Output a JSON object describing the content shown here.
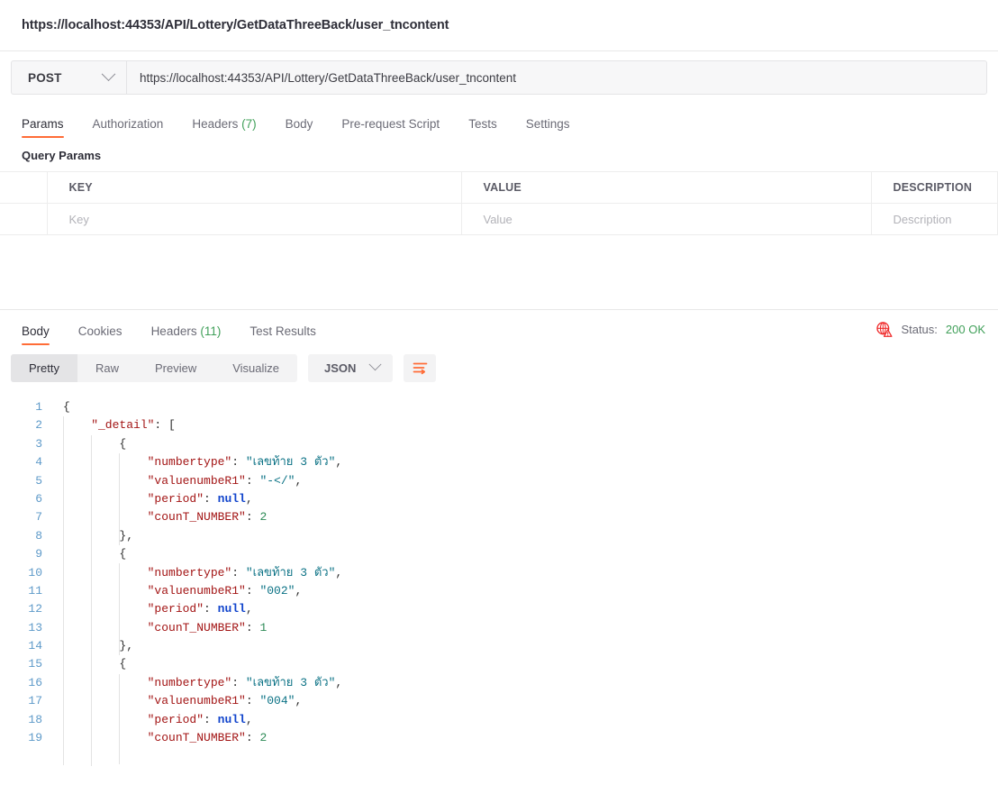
{
  "title_bar": {
    "url_title": "https://localhost:44353/API/Lottery/GetDataThreeBack/user_tncontent"
  },
  "request": {
    "method": "POST",
    "url": "https://localhost:44353/API/Lottery/GetDataThreeBack/user_tncontent"
  },
  "request_tabs": [
    {
      "label": "Params",
      "count": "",
      "active": true
    },
    {
      "label": "Authorization",
      "count": "",
      "active": false
    },
    {
      "label": "Headers",
      "count": "(7)",
      "active": false
    },
    {
      "label": "Body",
      "count": "",
      "active": false
    },
    {
      "label": "Pre-request Script",
      "count": "",
      "active": false
    },
    {
      "label": "Tests",
      "count": "",
      "active": false
    },
    {
      "label": "Settings",
      "count": "",
      "active": false
    }
  ],
  "params": {
    "section_label": "Query Params",
    "columns": [
      "KEY",
      "VALUE",
      "DESCRIPTION"
    ],
    "rows": [
      {
        "key": "Key",
        "value": "Value",
        "description": "Description"
      }
    ]
  },
  "response_tabs": [
    {
      "label": "Body",
      "count": "",
      "active": true
    },
    {
      "label": "Cookies",
      "count": "",
      "active": false
    },
    {
      "label": "Headers",
      "count": "(11)",
      "active": false
    },
    {
      "label": "Test Results",
      "count": "",
      "active": false
    }
  ],
  "response_status": {
    "icon": "globe-warning-icon",
    "label": "Status:",
    "value": "200 OK",
    "ok_color": "#41a05a",
    "icon_color": "#ef2b2b"
  },
  "viewer": {
    "modes": [
      {
        "label": "Pretty",
        "active": true
      },
      {
        "label": "Raw",
        "active": false
      },
      {
        "label": "Preview",
        "active": false
      },
      {
        "label": "Visualize",
        "active": false
      }
    ],
    "format": "JSON",
    "wrap_icon": "wrap-lines-icon",
    "accent": "#ff6c37"
  },
  "code": {
    "language": "json",
    "lines": [
      {
        "n": 1,
        "tokens": [
          {
            "t": "{",
            "c": "tk-brace"
          }
        ]
      },
      {
        "n": 2,
        "tokens": [
          {
            "t": "    \"_detail\"",
            "c": "tk-key"
          },
          {
            "t": ": [",
            "c": "tk-punc"
          }
        ]
      },
      {
        "n": 3,
        "tokens": [
          {
            "t": "        {",
            "c": "tk-punc"
          }
        ]
      },
      {
        "n": 4,
        "tokens": [
          {
            "t": "            \"numbertype\"",
            "c": "tk-key"
          },
          {
            "t": ": ",
            "c": "tk-punc"
          },
          {
            "t": "\"เลขท้าย 3 ตัว\"",
            "c": "tk-str"
          },
          {
            "t": ",",
            "c": "tk-punc"
          }
        ]
      },
      {
        "n": 5,
        "tokens": [
          {
            "t": "            \"valuenumbeR1\"",
            "c": "tk-key"
          },
          {
            "t": ": ",
            "c": "tk-punc"
          },
          {
            "t": "\"-</\"",
            "c": "tk-str"
          },
          {
            "t": ",",
            "c": "tk-punc"
          }
        ]
      },
      {
        "n": 6,
        "tokens": [
          {
            "t": "            \"period\"",
            "c": "tk-key"
          },
          {
            "t": ": ",
            "c": "tk-punc"
          },
          {
            "t": "null",
            "c": "tk-null"
          },
          {
            "t": ",",
            "c": "tk-punc"
          }
        ]
      },
      {
        "n": 7,
        "tokens": [
          {
            "t": "            \"counT_NUMBER\"",
            "c": "tk-key"
          },
          {
            "t": ": ",
            "c": "tk-punc"
          },
          {
            "t": "2",
            "c": "tk-num"
          }
        ]
      },
      {
        "n": 8,
        "tokens": [
          {
            "t": "        },",
            "c": "tk-punc"
          }
        ]
      },
      {
        "n": 9,
        "tokens": [
          {
            "t": "        {",
            "c": "tk-punc"
          }
        ]
      },
      {
        "n": 10,
        "tokens": [
          {
            "t": "            \"numbertype\"",
            "c": "tk-key"
          },
          {
            "t": ": ",
            "c": "tk-punc"
          },
          {
            "t": "\"เลขท้าย 3 ตัว\"",
            "c": "tk-str"
          },
          {
            "t": ",",
            "c": "tk-punc"
          }
        ]
      },
      {
        "n": 11,
        "tokens": [
          {
            "t": "            \"valuenumbeR1\"",
            "c": "tk-key"
          },
          {
            "t": ": ",
            "c": "tk-punc"
          },
          {
            "t": "\"002\"",
            "c": "tk-str"
          },
          {
            "t": ",",
            "c": "tk-punc"
          }
        ]
      },
      {
        "n": 12,
        "tokens": [
          {
            "t": "            \"period\"",
            "c": "tk-key"
          },
          {
            "t": ": ",
            "c": "tk-punc"
          },
          {
            "t": "null",
            "c": "tk-null"
          },
          {
            "t": ",",
            "c": "tk-punc"
          }
        ]
      },
      {
        "n": 13,
        "tokens": [
          {
            "t": "            \"counT_NUMBER\"",
            "c": "tk-key"
          },
          {
            "t": ": ",
            "c": "tk-punc"
          },
          {
            "t": "1",
            "c": "tk-num"
          }
        ]
      },
      {
        "n": 14,
        "tokens": [
          {
            "t": "        },",
            "c": "tk-punc"
          }
        ]
      },
      {
        "n": 15,
        "tokens": [
          {
            "t": "        {",
            "c": "tk-punc"
          }
        ]
      },
      {
        "n": 16,
        "tokens": [
          {
            "t": "            \"numbertype\"",
            "c": "tk-key"
          },
          {
            "t": ": ",
            "c": "tk-punc"
          },
          {
            "t": "\"เลขท้าย 3 ตัว\"",
            "c": "tk-str"
          },
          {
            "t": ",",
            "c": "tk-punc"
          }
        ]
      },
      {
        "n": 17,
        "tokens": [
          {
            "t": "            \"valuenumbeR1\"",
            "c": "tk-key"
          },
          {
            "t": ": ",
            "c": "tk-punc"
          },
          {
            "t": "\"004\"",
            "c": "tk-str"
          },
          {
            "t": ",",
            "c": "tk-punc"
          }
        ]
      },
      {
        "n": 18,
        "tokens": [
          {
            "t": "            \"period\"",
            "c": "tk-key"
          },
          {
            "t": ": ",
            "c": "tk-punc"
          },
          {
            "t": "null",
            "c": "tk-null"
          },
          {
            "t": ",",
            "c": "tk-punc"
          }
        ]
      },
      {
        "n": 19,
        "tokens": [
          {
            "t": "            \"counT_NUMBER\"",
            "c": "tk-key"
          },
          {
            "t": ": ",
            "c": "tk-punc"
          },
          {
            "t": "2",
            "c": "tk-num"
          }
        ]
      }
    ]
  }
}
